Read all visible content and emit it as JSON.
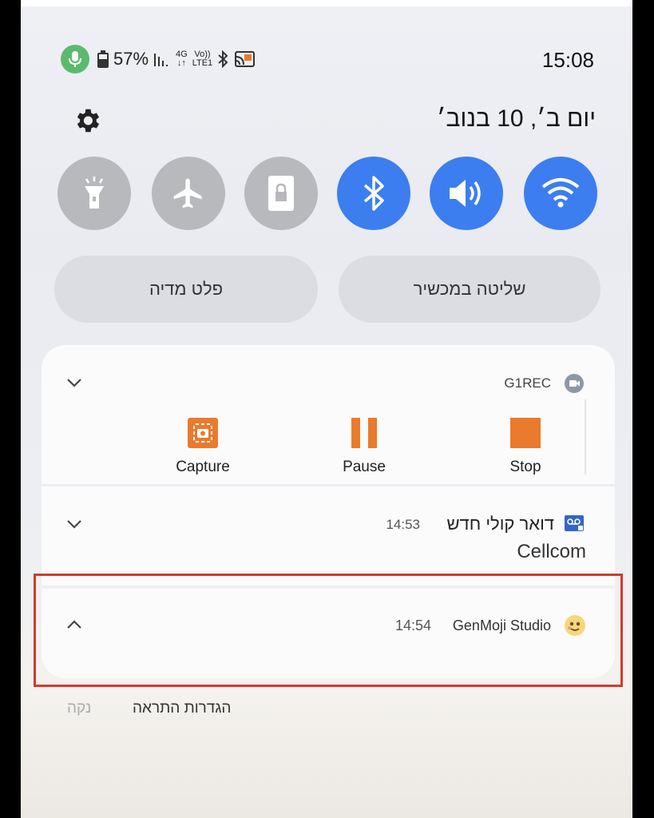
{
  "status_bar": {
    "battery": "57%",
    "network_4g": "4G",
    "volte_top": "Vo))",
    "volte_bottom": "LTE1",
    "time": "15:08"
  },
  "header": {
    "date": "יום ב׳, 10 בנוב׳"
  },
  "quick_tiles": [
    {
      "icon": "flashlight-icon",
      "state": "off"
    },
    {
      "icon": "airplane-icon",
      "state": "off"
    },
    {
      "icon": "rotation-lock-icon",
      "state": "off"
    },
    {
      "icon": "bluetooth-icon",
      "state": "on"
    },
    {
      "icon": "sound-icon",
      "state": "on"
    },
    {
      "icon": "wifi-icon",
      "state": "on"
    }
  ],
  "pills": {
    "media_output": "פלט מדיה",
    "device_control": "שליטה במכשיר"
  },
  "notifications": {
    "g1rec": {
      "app": "G1REC",
      "actions": {
        "capture": "Capture",
        "pause": "Pause",
        "stop": "Stop"
      }
    },
    "voicemail": {
      "title": "דואר קולי חדש",
      "time": "14:53",
      "body": "Cellcom"
    },
    "genmoji": {
      "app": "GenMoji Studio",
      "time": "14:54"
    }
  },
  "footer": {
    "settings": "הגדרות התראה",
    "clear": "נקה"
  },
  "colors": {
    "tile_on": "#3c7ef0",
    "tile_off": "#b8b9bc",
    "accent_orange": "#ea7a2c",
    "highlight": "#d03b2f"
  }
}
